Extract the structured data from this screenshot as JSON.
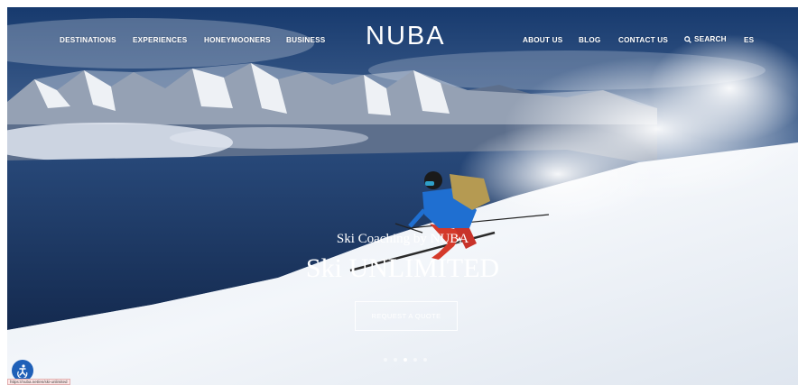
{
  "brand": {
    "logo": "NUBA"
  },
  "nav": {
    "left": [
      "DESTINATIONS",
      "EXPERIENCES",
      "HONEYMOONERS",
      "BUSINESS"
    ],
    "right": [
      "ABOUT US",
      "BLOG",
      "CONTACT US"
    ],
    "search_label": "SEARCH",
    "language": "ES"
  },
  "hero": {
    "kicker": "Ski Coaching by NUBA",
    "headline": "Ski UNLIMITED",
    "cta_label": "REQUEST A QUOTE",
    "slide_count": 5,
    "active_slide": 3
  },
  "status_bar": {
    "url": "https://nuba.net/en/ski-unlimited"
  },
  "colors": {
    "text": "#ffffff",
    "a11y_button": "#1f60b8"
  },
  "icons": [
    "search-icon",
    "accessibility-icon"
  ]
}
